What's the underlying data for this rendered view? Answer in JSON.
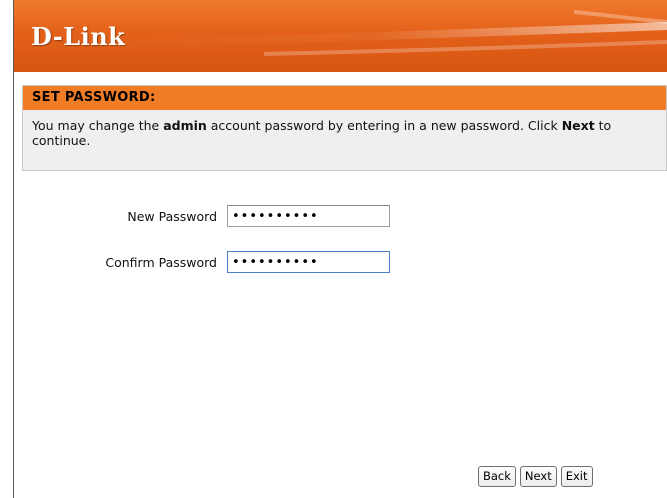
{
  "brand": {
    "logo_text": "D-Link",
    "header_color": "#e4611a"
  },
  "section": {
    "title": "SET PASSWORD:",
    "text_before_admin": "You may change the ",
    "admin_word": "admin",
    "text_after_admin": " account password by entering in a new password. Click ",
    "next_word": "Next",
    "text_end": " to continue.",
    "title_color": "#f07c26"
  },
  "form": {
    "new_password": {
      "label": "New Password",
      "value": "••••••••••"
    },
    "confirm_password": {
      "label": "Confirm Password",
      "value": "••••••••••"
    }
  },
  "buttons": {
    "back_label": "Back",
    "next_label": "Next",
    "exit_label": "Exit"
  }
}
